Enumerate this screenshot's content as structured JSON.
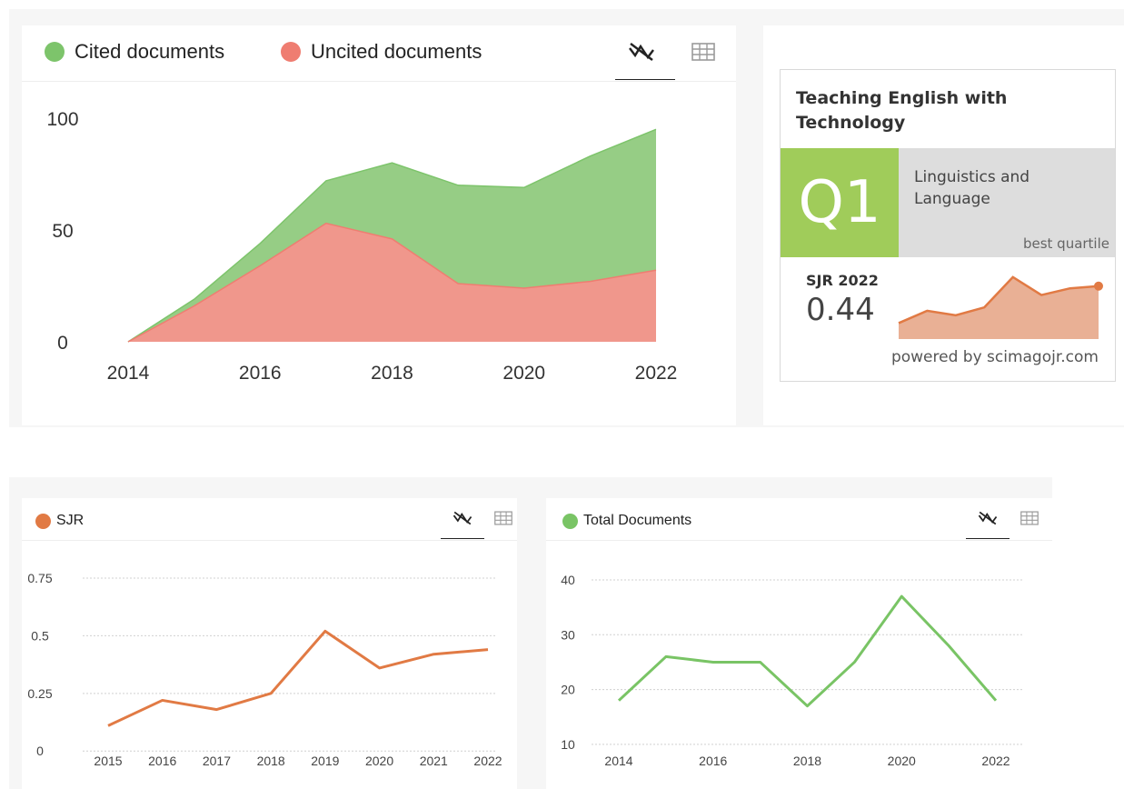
{
  "colors": {
    "cited": "#7dc46b",
    "cited_fill": "#96cd85",
    "uncited": "#ef7d71",
    "uncited_fill": "#f0978c",
    "sjr": "#e17a44",
    "total_docs": "#79c465",
    "q1": "#a0cc5a"
  },
  "top_chart": {
    "legend": {
      "cited": "Cited documents",
      "uncited": "Uncited documents"
    },
    "icons": {
      "chart": "chart-view-icon",
      "table": "table-view-icon"
    }
  },
  "sjr_panel": {
    "legend": "SJR",
    "icons": {
      "chart": "chart-view-icon",
      "table": "table-view-icon"
    }
  },
  "docs_panel": {
    "legend": "Total Documents",
    "icons": {
      "chart": "chart-view-icon",
      "table": "table-view-icon"
    }
  },
  "widget": {
    "journal_title_line1": "Teaching English with",
    "journal_title_line2": "Technology",
    "quartile": "Q1",
    "category_line1": "Linguistics and",
    "category_line2": "Language",
    "best_quartile": "best quartile",
    "sjr_label": "SJR 2022",
    "sjr_value": "0.44",
    "powered_by": "powered by scimagojr.com",
    "sparkline": [
      0.11,
      0.22,
      0.18,
      0.25,
      0.52,
      0.36,
      0.42,
      0.44
    ]
  },
  "chart_data": [
    {
      "type": "area",
      "x": [
        2014,
        2015,
        2016,
        2017,
        2018,
        2019,
        2020,
        2021,
        2022
      ],
      "series": [
        {
          "name": "Cited documents",
          "values": [
            0,
            3,
            10,
            19,
            34,
            44,
            45,
            56,
            63
          ]
        },
        {
          "name": "Uncited documents",
          "values": [
            0,
            16,
            34,
            53,
            46,
            26,
            24,
            27,
            32
          ]
        }
      ],
      "stacked": true,
      "ylim": [
        0,
        100
      ],
      "yticks": [
        0,
        50,
        100
      ],
      "xticks": [
        2014,
        2016,
        2018,
        2020,
        2022
      ],
      "legend_position": "top-left"
    },
    {
      "type": "line",
      "x": [
        2015,
        2016,
        2017,
        2018,
        2019,
        2020,
        2021,
        2022
      ],
      "series": [
        {
          "name": "SJR",
          "values": [
            0.11,
            0.22,
            0.18,
            0.25,
            0.52,
            0.36,
            0.42,
            0.44
          ]
        }
      ],
      "yticks": [
        0,
        0.25,
        0.5,
        0.75
      ],
      "ytick_labels": [
        "0",
        "0.25",
        "0.5",
        "0.75"
      ],
      "ylim": [
        -0.07,
        0.75
      ],
      "xticks": [
        2015,
        2016,
        2017,
        2018,
        2019,
        2020,
        2021,
        2022
      ],
      "grid": true,
      "legend_position": "top-left"
    },
    {
      "type": "line",
      "x": [
        2014,
        2015,
        2016,
        2017,
        2018,
        2019,
        2020,
        2021,
        2022
      ],
      "series": [
        {
          "name": "Total Documents",
          "values": [
            18,
            26,
            25,
            25,
            17,
            25,
            37,
            28,
            18
          ]
        }
      ],
      "yticks": [
        10,
        20,
        30,
        40
      ],
      "ylim": [
        7,
        40
      ],
      "xticks": [
        2014,
        2016,
        2018,
        2020,
        2022
      ],
      "grid": true,
      "legend_position": "top-left"
    }
  ]
}
